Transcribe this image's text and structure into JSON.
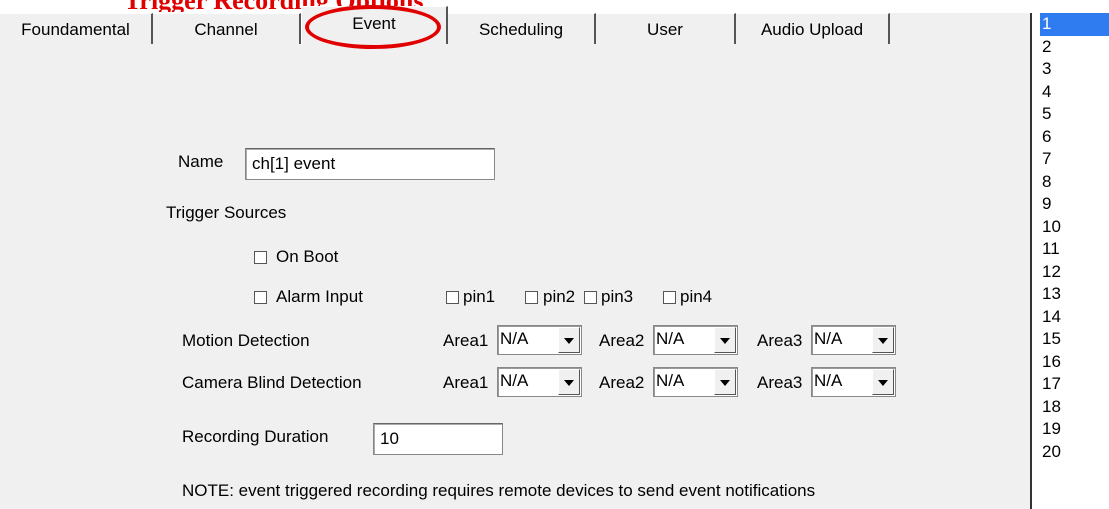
{
  "caption": "Trigger Recording Options",
  "tabs": [
    {
      "label": "Foundamental"
    },
    {
      "label": "Channel"
    },
    {
      "label": "Event"
    },
    {
      "label": "Scheduling"
    },
    {
      "label": "User"
    },
    {
      "label": "Audio Upload"
    }
  ],
  "form": {
    "name_label": "Name",
    "name_value": "ch[1] event",
    "trigger_sources_label": "Trigger Sources",
    "on_boot_label": "On Boot",
    "alarm_input_label": "Alarm Input",
    "pins": [
      "pin1",
      "pin2",
      "pin3",
      "pin4"
    ],
    "motion_label": "Motion Detection",
    "blind_label": "Camera Blind Detection",
    "areas": [
      "Area1",
      "Area2",
      "Area3"
    ],
    "motion_values": [
      "N/A",
      "N/A",
      "N/A"
    ],
    "blind_values": [
      "N/A",
      "N/A",
      "N/A"
    ],
    "duration_label": "Recording Duration",
    "duration_value": "10",
    "note": "NOTE: event triggered recording requires remote devices to send event notifications"
  },
  "channel_list": [
    "1",
    "2",
    "3",
    "4",
    "5",
    "6",
    "7",
    "8",
    "9",
    "10",
    "11",
    "12",
    "13",
    "14",
    "15",
    "16",
    "17",
    "18",
    "19",
    "20"
  ],
  "colors": {
    "highlight_circle": "#e00000",
    "selected_item": "#2f7bf0"
  }
}
